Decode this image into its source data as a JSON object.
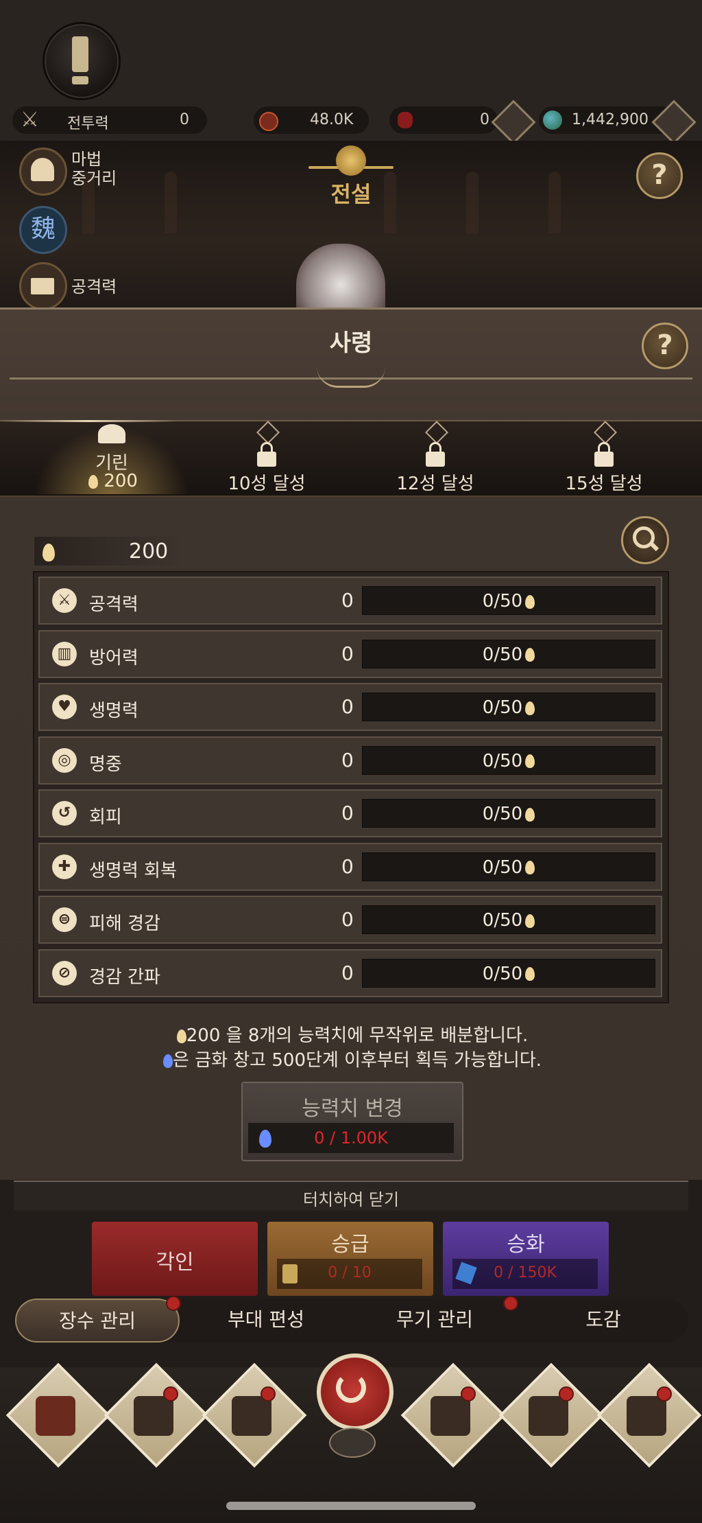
{
  "top": {
    "combat_label": "전투력",
    "combat_value": "0",
    "currency1": "48.0K",
    "currency2": "0",
    "currency3": "1,442,900"
  },
  "scene": {
    "badge_text": "전설",
    "side_items": [
      {
        "label": "마법\n중거리",
        "icon": "magic-fan-icon"
      },
      {
        "label": "",
        "icon": "wei-kingdom-icon",
        "glyph": "魏"
      },
      {
        "label": "공격력",
        "icon": "book-icon"
      }
    ]
  },
  "panel": {
    "title": "사령",
    "tabs": [
      {
        "label": "기린",
        "sub": "200",
        "active": true
      },
      {
        "label": "10성 달성",
        "locked": true
      },
      {
        "label": "12성 달성",
        "locked": true
      },
      {
        "label": "15성 달성",
        "locked": true
      }
    ],
    "points": "200",
    "stats": [
      {
        "name": "공격력",
        "value": "0",
        "progress": "0/50",
        "icon": "crossed-swords-icon",
        "glyph": "⚔"
      },
      {
        "name": "방어력",
        "value": "0",
        "progress": "0/50",
        "icon": "shield-icon",
        "glyph": "▥"
      },
      {
        "name": "생명력",
        "value": "0",
        "progress": "0/50",
        "icon": "heart-icon",
        "glyph": "♥"
      },
      {
        "name": "명중",
        "value": "0",
        "progress": "0/50",
        "icon": "target-icon",
        "glyph": "◎"
      },
      {
        "name": "회피",
        "value": "0",
        "progress": "0/50",
        "icon": "dodge-arrow-icon",
        "glyph": "↺"
      },
      {
        "name": "생명력 회복",
        "value": "0",
        "progress": "0/50",
        "icon": "heart-plus-icon",
        "glyph": "✚"
      },
      {
        "name": "피해 경감",
        "value": "0",
        "progress": "0/50",
        "icon": "damage-reduce-icon",
        "glyph": "⊜"
      },
      {
        "name": "경감 간파",
        "value": "0",
        "progress": "0/50",
        "icon": "pierce-icon",
        "glyph": "⊘"
      }
    ],
    "info_line1": "200 을 8개의 능력치에 무작위로 배분합니다.",
    "info_line2": "은 금화 창고 500단계 이후부터 획득 가능합니다.",
    "change_button": "능력치 변경",
    "change_cost": "0 / 1.00K"
  },
  "bottom": {
    "close_hint": "터치하여 닫기",
    "buttons": [
      {
        "label": "각인"
      },
      {
        "label": "승급",
        "cost": "0 / 10"
      },
      {
        "label": "승화",
        "cost": "0 / 150K"
      }
    ],
    "nav_tabs": [
      "장수 관리",
      "부대 편성",
      "무기 관리",
      "도감"
    ]
  },
  "colors": {
    "accent_gold": "#c9b38a",
    "alert_red": "#b42622",
    "cost_red": "#d2302a"
  }
}
